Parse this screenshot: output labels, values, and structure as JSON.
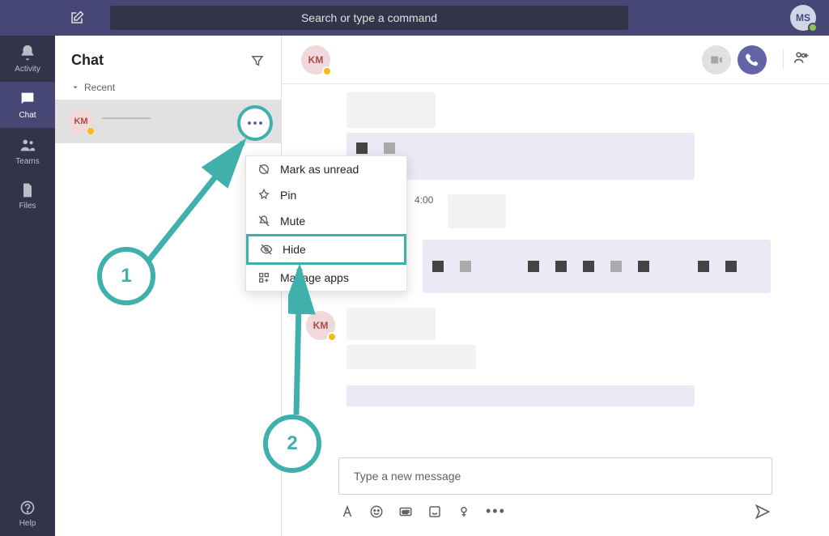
{
  "search": {
    "placeholder": "Search or type a command"
  },
  "me": {
    "initials": "MS"
  },
  "rail": {
    "activity": "Activity",
    "chat": "Chat",
    "teams": "Teams",
    "files": "Files",
    "help": "Help"
  },
  "panel": {
    "title": "Chat",
    "recent": "Recent"
  },
  "chat_list": [
    {
      "avatar_initials": "KM"
    }
  ],
  "ctx": {
    "mark_unread": "Mark as unread",
    "pin": "Pin",
    "mute": "Mute",
    "hide": "Hide",
    "manage_apps": "Manage apps"
  },
  "conv": {
    "avatar_initials": "KM",
    "timestamp": "4:00",
    "compose_placeholder": "Type a new message"
  },
  "callouts": {
    "one": "1",
    "two": "2"
  },
  "colors": {
    "accent": "#6264a7",
    "teal": "#3fb0ac",
    "away": "#fdb913"
  }
}
